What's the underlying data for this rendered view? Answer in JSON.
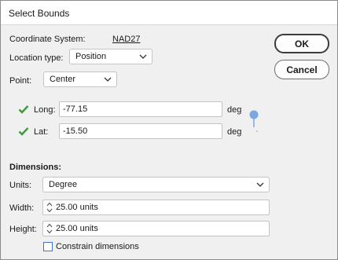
{
  "dialog": {
    "title": "Select Bounds",
    "ok_label": "OK",
    "cancel_label": "Cancel"
  },
  "coordinate_system": {
    "label": "Coordinate System:",
    "value": "NAD27"
  },
  "location_type": {
    "label": "Location type:",
    "selected": "Position"
  },
  "point": {
    "label": "Point:",
    "selected": "Center"
  },
  "long": {
    "label": "Long:",
    "value": "-77.15",
    "unit": "deg"
  },
  "lat": {
    "label": "Lat:",
    "value": "-15.50",
    "unit": "deg"
  },
  "dimensions": {
    "heading": "Dimensions:",
    "units_label": "Units:",
    "units_selected": "Degree",
    "width_label": "Width:",
    "width_value": "25.00 units",
    "height_label": "Height:",
    "height_value": "25.00 units",
    "constrain_label": "Constrain dimensions",
    "constrain_checked": false
  },
  "colors": {
    "check": "#3c9a3c",
    "pin": "#7ba7e0",
    "checkbox_border": "#3e72c4"
  },
  "icons": [
    "check-icon",
    "chevron-down-icon",
    "spin-arrows-icon",
    "map-pin-icon"
  ]
}
